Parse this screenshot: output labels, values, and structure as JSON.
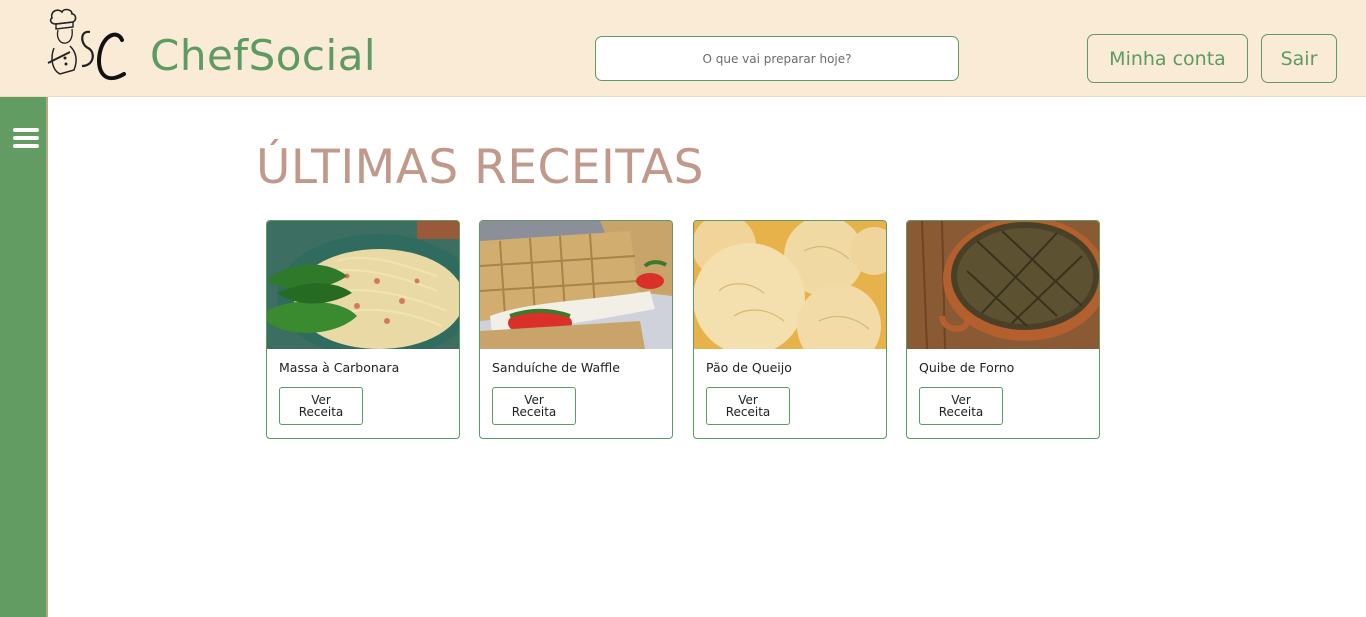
{
  "header": {
    "brand": "ChefSocial",
    "search_placeholder": "O que vai preparar hoje?",
    "account_label": "Minha conta",
    "logout_label": "Sair"
  },
  "main": {
    "title": "ÚLTIMAS RECEITAS",
    "recipes": [
      {
        "name": "Massa à Carbonara",
        "button": "Ver Receita"
      },
      {
        "name": "Sanduíche de Waffle",
        "button": "Ver Receita"
      },
      {
        "name": "Pão de Queijo",
        "button": "Ver Receita"
      },
      {
        "name": "Quibe de Forno",
        "button": "Ver Receita"
      }
    ]
  },
  "colors": {
    "header_bg": "#faebd7",
    "accent_green": "#5e9a63",
    "sidebar_green": "#639c63",
    "title_color": "#c0998a"
  },
  "icons": {
    "logo": "chef-logo-icon",
    "menu": "hamburger-menu-icon"
  }
}
